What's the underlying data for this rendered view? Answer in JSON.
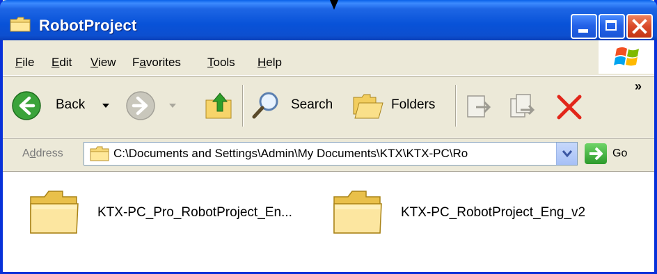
{
  "window": {
    "title": "RobotProject",
    "controls": [
      "minimize",
      "maximize",
      "close"
    ]
  },
  "menu": {
    "items": [
      "File",
      "Edit",
      "View",
      "Favorites",
      "Tools",
      "Help"
    ]
  },
  "toolbar": {
    "back_label": "Back",
    "search_label": "Search",
    "folders_label": "Folders",
    "overflow_label": "»"
  },
  "address": {
    "label": "Address",
    "value": "C:\\Documents and Settings\\Admin\\My Documents\\KTX\\KTX-PC\\Ro",
    "go_label": "Go"
  },
  "content": {
    "items": [
      {
        "name": "KTX-PC_Pro_RobotProject_En...",
        "type": "folder"
      },
      {
        "name": "KTX-PC_RobotProject_Eng_v2",
        "type": "folder"
      }
    ]
  },
  "icons": {
    "folder": "folder-icon",
    "back": "back-arrow-icon",
    "forward": "forward-arrow-icon",
    "up": "up-folder-icon",
    "search": "magnifier-icon",
    "folders": "folders-icon",
    "move_to": "move-to-icon",
    "copy_to": "copy-to-icon",
    "delete": "delete-x-icon"
  },
  "colors": {
    "titlebar": "#0A58D8",
    "close_button": "#D9492A",
    "chrome": "#ECE9D8",
    "go_button": "#2C9A2B"
  }
}
